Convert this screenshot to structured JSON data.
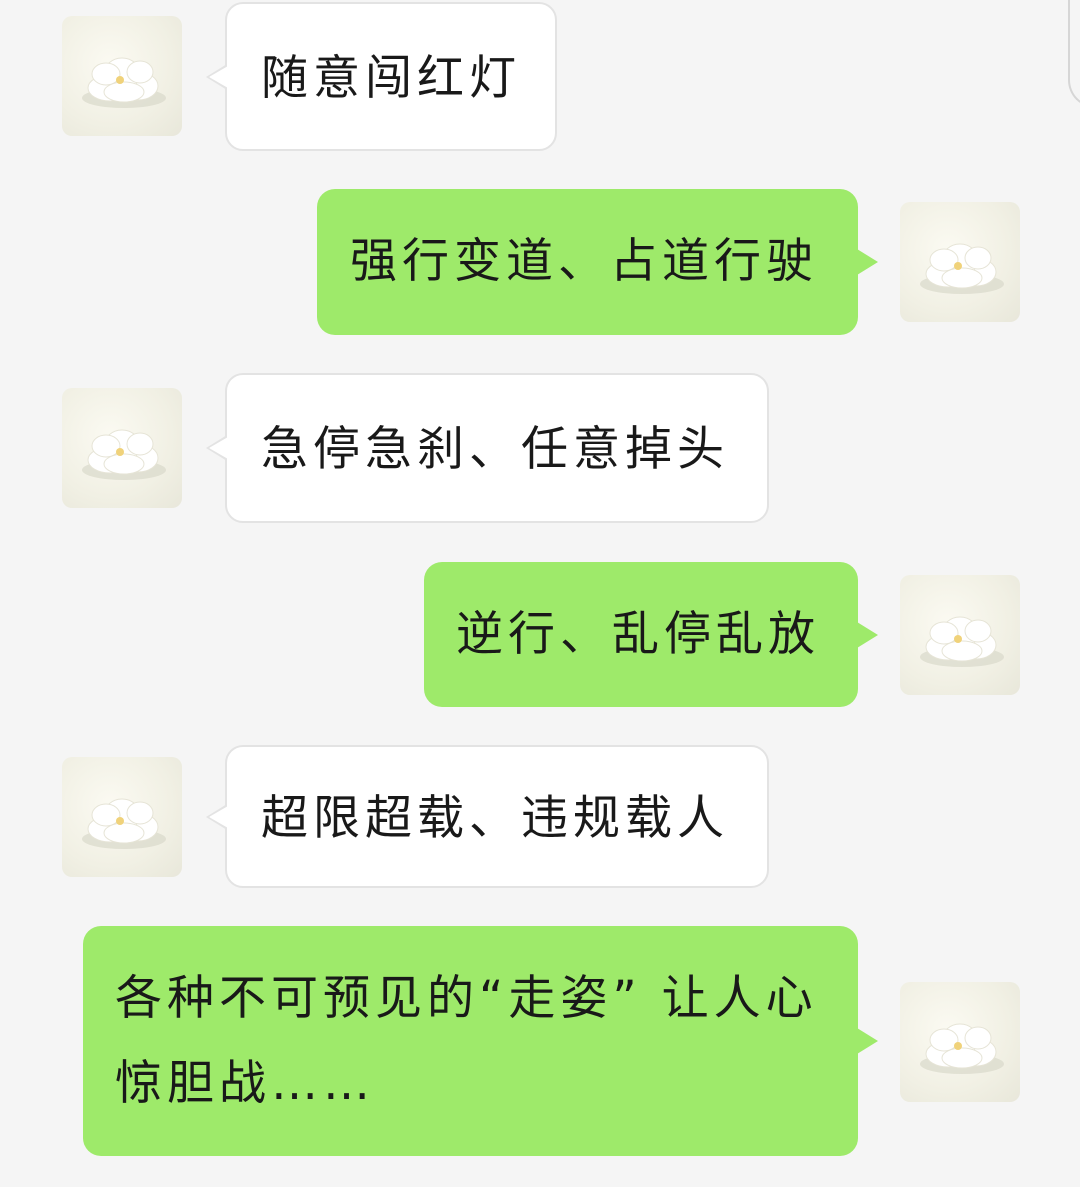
{
  "messages": [
    {
      "sender": "other",
      "text": "随意闯红灯"
    },
    {
      "sender": "self",
      "text": "强行变道、占道行驶"
    },
    {
      "sender": "other",
      "text": "急停急刹、任意掉头"
    },
    {
      "sender": "self",
      "text": "逆行、乱停乱放"
    },
    {
      "sender": "other",
      "text": "超限超载、违规载人"
    },
    {
      "sender": "self",
      "text": "各种不可预见的“走姿” 让人心惊胆战……"
    }
  ],
  "colors": {
    "background": "#f5f5f5",
    "incoming_bubble": "#ffffff",
    "outgoing_bubble": "#9eea6a",
    "text": "#191919"
  },
  "icons": {
    "avatar": "white-flower-avatar"
  }
}
